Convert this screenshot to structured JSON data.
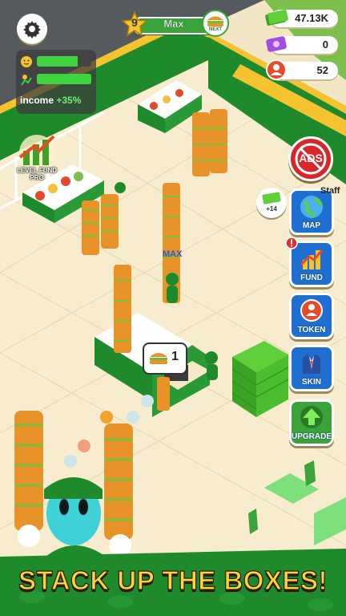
{
  "hud": {
    "player_level": "9",
    "player_name": "Max",
    "next_label": "NEXT",
    "money": "47.13K",
    "tokens": "0",
    "customers": "52",
    "income_label": "income",
    "income_bonus": "+35%",
    "satisfaction_fraction": 0.75,
    "efficiency_fraction": 1.0
  },
  "level_fund": {
    "label": "LEVEL FUND PRO"
  },
  "side_buttons": {
    "ads": "ADS",
    "reward": "+14",
    "map": "MAP",
    "fund": "FUND",
    "token": "TOKEN",
    "skin": "SKIN",
    "upgrade": "UPGRADE"
  },
  "world": {
    "player_tag": "MAX",
    "order_count": "1",
    "staff_sign": "Staff"
  },
  "banner": {
    "text": "STACK UP THE BOXES!"
  },
  "colors": {
    "brand_green": "#1f8a2c",
    "wall_yellow": "#f5c230",
    "banner_yellow": "#ffd43a",
    "ads_red": "#d8262b",
    "button_blue": "#1e6fd0"
  }
}
